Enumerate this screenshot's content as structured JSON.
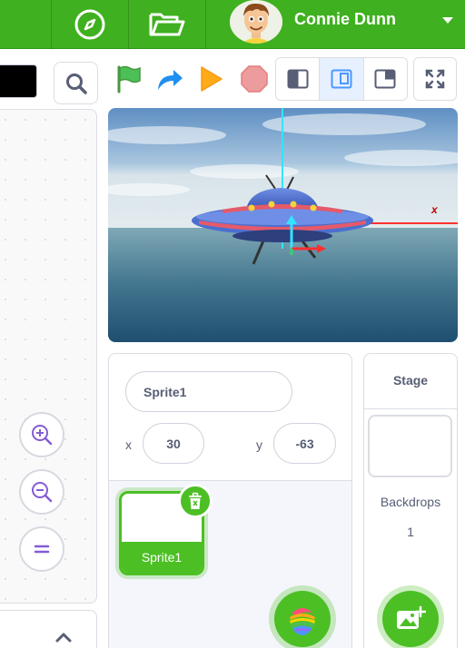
{
  "user": {
    "name": "Connie Dunn"
  },
  "sprite": {
    "name": "Sprite1",
    "x_label": "x",
    "x_value": "30",
    "y_label": "y",
    "y_value": "-63",
    "card_label": "Sprite1"
  },
  "stage_pane": {
    "title": "Stage",
    "backdrops_label": "Backdrops",
    "backdrops_count": "1"
  },
  "stage_axis_label": "x",
  "icons": {
    "explore": "compass-icon",
    "folder": "folder-icon",
    "search": "search-icon",
    "green_flag": "green-flag-icon",
    "redo": "redo-arrow-icon",
    "play": "play-icon",
    "stop": "stop-icon",
    "fullscreen": "fullscreen-icon"
  },
  "colors": {
    "topbar": "#3fb01f",
    "accent_green": "#4cbf24",
    "selected_mode": "#4c97ff",
    "stop": "#ec9c9c",
    "play": "#ffab19"
  }
}
